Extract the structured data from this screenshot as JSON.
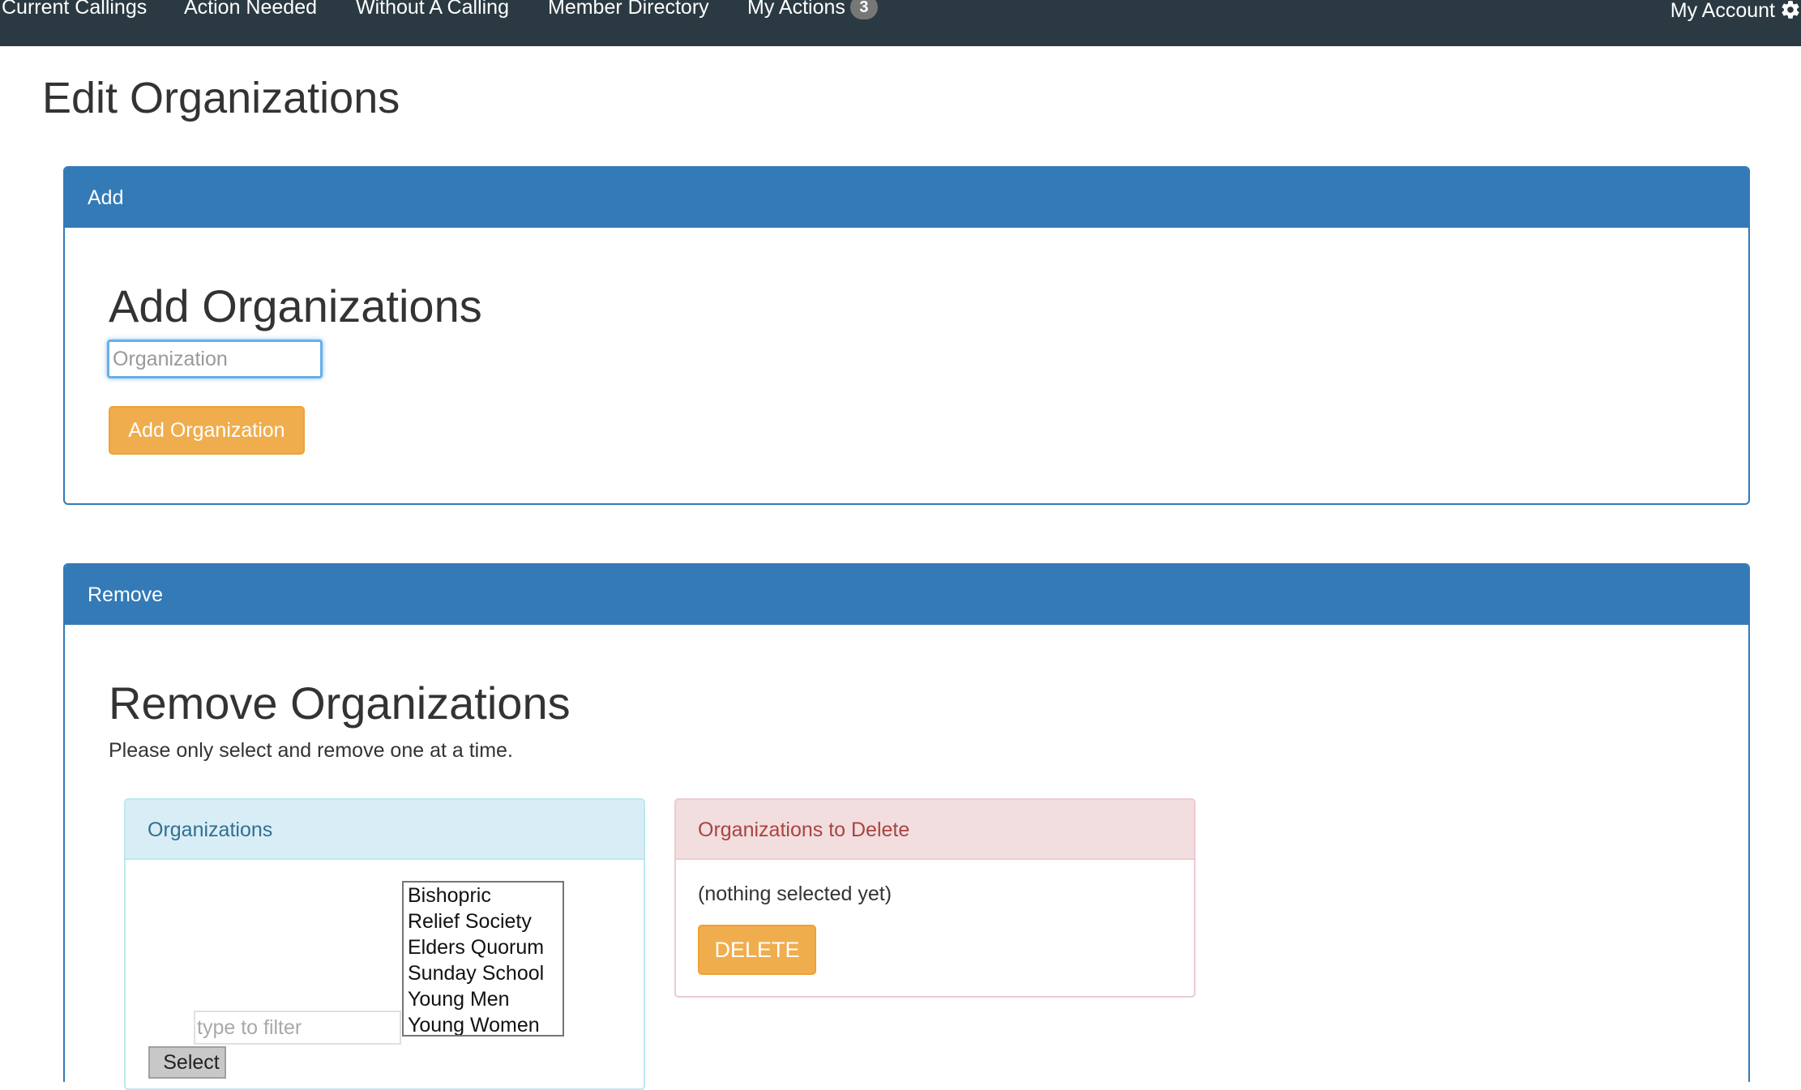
{
  "nav": {
    "items": [
      {
        "label": "Current Callings"
      },
      {
        "label": "Action Needed"
      },
      {
        "label": "Without A Calling"
      },
      {
        "label": "Member Directory"
      },
      {
        "label": "My Actions",
        "badge": "3"
      }
    ],
    "account_label": "My Account",
    "account_icon": "gear-icon"
  },
  "page": {
    "title": "Edit Organizations"
  },
  "add_panel": {
    "heading": "Add",
    "title": "Add Organizations",
    "input_placeholder": "Organization",
    "input_value": "",
    "button_label": "Add Organization"
  },
  "remove_panel": {
    "heading": "Remove",
    "title": "Remove Organizations",
    "help_text": "Please only select and remove one at a time.",
    "organizations": {
      "heading": "Organizations",
      "options": [
        "Bishopric",
        "Relief Society",
        "Elders Quorum",
        "Sunday School",
        "Young Men",
        "Young Women"
      ],
      "filter_placeholder": "type to filter",
      "select_label": "Select"
    },
    "to_delete": {
      "heading": "Organizations to Delete",
      "empty_text": "(nothing selected yet)",
      "delete_label": "DELETE"
    }
  },
  "colors": {
    "navbar": "#2b3a42",
    "primary": "#337ab7",
    "warning": "#f0ad4e",
    "info_bg": "#d9edf7",
    "danger_bg": "#f2dede"
  }
}
